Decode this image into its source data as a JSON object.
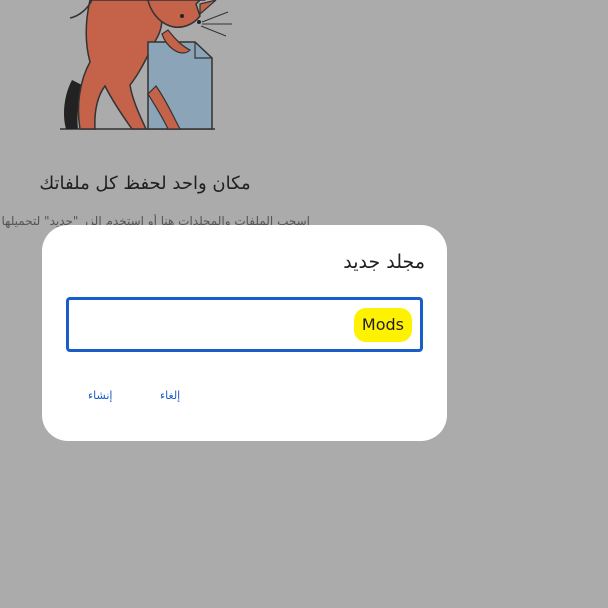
{
  "empty_state": {
    "title": "مكان واحد لحفظ كل ملفاتك",
    "subtitle": "اسحب الملفات والمجلدات هنا أو استخدم الزر \"جديد\" لتحميلها"
  },
  "dialog": {
    "title": "مجلد جديد",
    "input_value": "Mods",
    "cancel_label": "إلغاء",
    "create_label": "إنشاء"
  },
  "colors": {
    "backdrop": "#ababab",
    "accent": "#1a5cc8",
    "highlight": "#fff200",
    "cat": "#c4634a",
    "document": "#8ba4b8"
  },
  "icons": {
    "illustration": "cat-with-document-illustration"
  }
}
